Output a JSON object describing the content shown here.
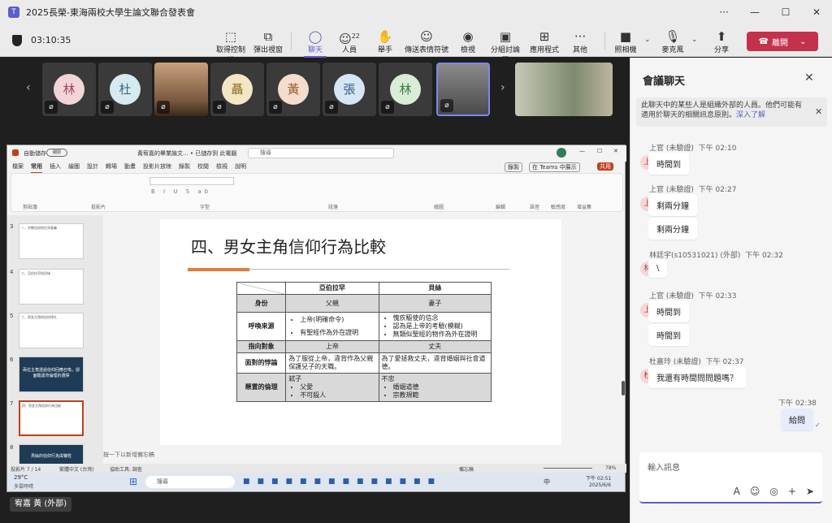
{
  "window": {
    "title": "2025長榮-東海兩校大學生論文聯合發表會"
  },
  "meeting": {
    "timer": "03:10:35",
    "toolbar": [
      {
        "label": "取得控制權",
        "icon": "take-control-icon"
      },
      {
        "label": "彈出視窗",
        "icon": "pop-out-icon"
      },
      {
        "label": "聊天",
        "icon": "chat-icon"
      },
      {
        "label": "人員",
        "icon": "people-icon",
        "badge": "22"
      },
      {
        "label": "舉手",
        "icon": "raise-hand-icon"
      },
      {
        "label": "傳送表情符號",
        "icon": "emoji-icon"
      },
      {
        "label": "檢視",
        "icon": "view-icon"
      },
      {
        "label": "分組討論區",
        "icon": "breakout-icon"
      },
      {
        "label": "應用程式",
        "icon": "apps-icon"
      },
      {
        "label": "其他",
        "icon": "more-icon"
      },
      {
        "label": "照相機",
        "icon": "camera-icon"
      },
      {
        "label": "麥克風",
        "icon": "mic-icon"
      },
      {
        "label": "分享",
        "icon": "share-icon"
      }
    ],
    "leave_label": "離開"
  },
  "participants": [
    {
      "initial": "林",
      "color": "#f2d4d9"
    },
    {
      "initial": "杜",
      "color": "#d6eaf0"
    },
    {
      "initial": "",
      "color": "#8b6a50",
      "video": true
    },
    {
      "initial": "聶",
      "color": "#f3e6c4"
    },
    {
      "initial": "黃",
      "color": "#f6dccc"
    },
    {
      "initial": "張",
      "color": "#d6e6f5"
    },
    {
      "initial": "林",
      "color": "#d8ecd6"
    },
    {
      "initial": "",
      "color": "#5a5a5a",
      "video": true
    },
    {
      "initial": "",
      "color": "#6a7a6a",
      "video": true
    }
  ],
  "ppt": {
    "autosave": "自動儲存",
    "autosave_state": "關閉",
    "filename": "黃宥嘉的畢業論文...  • 已儲存到 此電腦",
    "search_placeholder": "搜尋",
    "record": "錄製",
    "teams_present": "在 Teams 中展示",
    "share": "共用",
    "tabs": [
      "檔案",
      "常用",
      "插入",
      "繪圖",
      "設計",
      "轉場",
      "動畫",
      "投影片放映",
      "錄製",
      "校閱",
      "檢視",
      "說明"
    ],
    "ribbon_groups": [
      "剪貼簿",
      "投影片",
      "字型",
      "段落",
      "繪圖",
      "編輯",
      "語音",
      "敏感度",
      "增益集"
    ],
    "slide_numbers": [
      "3",
      "4",
      "5",
      "6",
      "7",
      "8"
    ],
    "thumb_texts": [
      "一、宗教信仰與生命意義",
      "二、亞伯拉罕與貝絲",
      "三、男女主角的信仰掙扎",
      "兩位主角透過信仰回應召喚，卻面臨違背倫理的選擇",
      "四、男女主角信仰行為比較",
      "貝絲的信仰行為與犧牲"
    ],
    "slide_title": "四、男女主角信仰行為比較",
    "table": {
      "col_headers": [
        "亞伯拉罕",
        "貝絲"
      ],
      "rows": [
        {
          "label": "身份",
          "a": "父親",
          "b": "妻子",
          "gray": true
        },
        {
          "label": "呼喚來源",
          "a_list": [
            "上帝(明確命令)",
            "有聖經作為外在證明"
          ],
          "b_list": [
            "愧疚驅使的信念",
            "認為是上帝的考驗(模糊)",
            "無類似聖經的物作為外在證明"
          ],
          "gray": false
        },
        {
          "label": "指向對象",
          "a": "上帝",
          "b": "丈夫",
          "gray": true
        },
        {
          "label": "面對的悖論",
          "a": "為了服從上帝，違背作為父親保護兒子的天職。",
          "b": "為了愛拯救丈夫，違背婚姻與社會道德。",
          "gray": false
        },
        {
          "label": "懸置的倫理",
          "a": "弒子",
          "a_list": [
            "父愛",
            "不可殺人"
          ],
          "b": "不忠",
          "b_list": [
            "婚姻道德",
            "宗教規範"
          ],
          "gray": true
        }
      ]
    },
    "notes_placeholder": "按一下以新增備忘稿",
    "status": {
      "slide_of": "投影片 7 / 14",
      "language": "繁體中文 (台灣)",
      "accessibility": "協助工具: 調查",
      "notes": "備忘稿",
      "zoom": "78%"
    }
  },
  "taskbar": {
    "weather_temp": "29°C",
    "weather_desc": "多雲時晴",
    "search": "搜尋",
    "ime": "中",
    "time": "下午 02:51",
    "date": "2025/6/6"
  },
  "presenter": {
    "name": "宥嘉 黃 (外部)"
  },
  "chat": {
    "title": "會議聊天",
    "banner": "此聊天中的某些人是組織外部的人員。他們可能有適用於聊天的相關訊息原則。",
    "banner_link": "深入了解",
    "messages": [
      {
        "sender": "上官 (未驗證)",
        "time": "下午 02:10",
        "initial": "上",
        "texts": [
          "時間到"
        ]
      },
      {
        "sender": "上官 (未驗證)",
        "time": "下午 02:27",
        "initial": "上",
        "texts": [
          "剩兩分鐘",
          "剩兩分鐘"
        ]
      },
      {
        "sender": "林廷宇(s10531021) (外部)",
        "time": "下午 02:32",
        "initial": "林",
        "texts": [
          "\\"
        ]
      },
      {
        "sender": "上官 (未驗證)",
        "time": "下午 02:33",
        "initial": "上",
        "texts": [
          "時間到",
          "時間到"
        ]
      },
      {
        "sender": "杜嘉玲 (未驗證)",
        "time": "下午 02:37",
        "initial": "杜",
        "texts": [
          "我還有時間問問題嗎？"
        ]
      }
    ],
    "my_message": {
      "time": "下午 02:38",
      "text": "給問"
    },
    "compose_placeholder": "輸入訊息"
  }
}
